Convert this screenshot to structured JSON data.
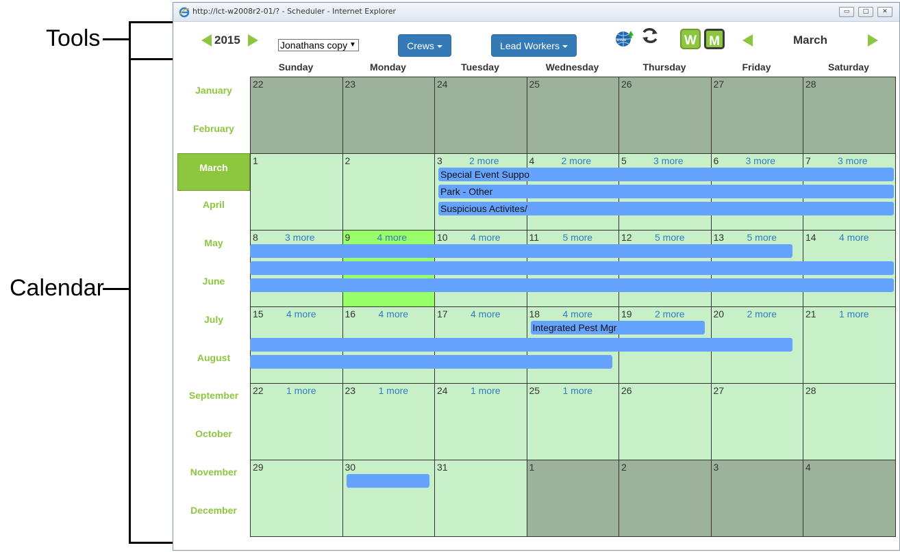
{
  "annotations": {
    "tools_label": "Tools",
    "calendar_label": "Calendar"
  },
  "window": {
    "title": "http://lct-w2008r2-01/? - Scheduler - Internet Explorer",
    "minimize": "▭",
    "restore": "□",
    "close": "✕"
  },
  "toolbar": {
    "year": "2015",
    "crew_select_value": "Jonathans copy",
    "crews_button": "Crews",
    "lead_workers_button": "Lead Workers",
    "week_view_label": "W",
    "month_view_label": "M",
    "current_month": "March"
  },
  "months": [
    "January",
    "February",
    "March",
    "April",
    "May",
    "June",
    "July",
    "August",
    "September",
    "October",
    "November",
    "December"
  ],
  "active_month_index": 2,
  "weekdays": [
    "Sunday",
    "Monday",
    "Tuesday",
    "Wednesday",
    "Thursday",
    "Friday",
    "Saturday"
  ],
  "weeks": [
    [
      {
        "d": "22",
        "t": "other"
      },
      {
        "d": "23",
        "t": "other"
      },
      {
        "d": "24",
        "t": "other"
      },
      {
        "d": "25",
        "t": "other"
      },
      {
        "d": "26",
        "t": "other"
      },
      {
        "d": "27",
        "t": "other"
      },
      {
        "d": "28",
        "t": "other"
      }
    ],
    [
      {
        "d": "1",
        "t": "cur"
      },
      {
        "d": "2",
        "t": "cur"
      },
      {
        "d": "3",
        "t": "cur",
        "more": "2 more"
      },
      {
        "d": "4",
        "t": "cur",
        "more": "2 more"
      },
      {
        "d": "5",
        "t": "cur",
        "more": "3 more"
      },
      {
        "d": "6",
        "t": "cur",
        "more": "3 more"
      },
      {
        "d": "7",
        "t": "cur",
        "more": "3 more"
      }
    ],
    [
      {
        "d": "8",
        "t": "cur",
        "more": "3 more"
      },
      {
        "d": "9",
        "t": "today",
        "more": "4 more"
      },
      {
        "d": "10",
        "t": "cur",
        "more": "4 more"
      },
      {
        "d": "11",
        "t": "cur",
        "more": "5 more"
      },
      {
        "d": "12",
        "t": "cur",
        "more": "5 more"
      },
      {
        "d": "13",
        "t": "cur",
        "more": "5 more"
      },
      {
        "d": "14",
        "t": "cur",
        "more": "4 more"
      }
    ],
    [
      {
        "d": "15",
        "t": "cur",
        "more": "4 more"
      },
      {
        "d": "16",
        "t": "cur",
        "more": "4 more"
      },
      {
        "d": "17",
        "t": "cur",
        "more": "4 more"
      },
      {
        "d": "18",
        "t": "cur",
        "more": "4 more"
      },
      {
        "d": "19",
        "t": "cur",
        "more": "2 more"
      },
      {
        "d": "20",
        "t": "cur",
        "more": "2 more"
      },
      {
        "d": "21",
        "t": "cur",
        "more": "1 more"
      }
    ],
    [
      {
        "d": "22",
        "t": "cur",
        "more": "1 more"
      },
      {
        "d": "23",
        "t": "cur",
        "more": "1 more"
      },
      {
        "d": "24",
        "t": "cur",
        "more": "1 more"
      },
      {
        "d": "25",
        "t": "cur",
        "more": "1 more"
      },
      {
        "d": "26",
        "t": "cur"
      },
      {
        "d": "27",
        "t": "cur"
      },
      {
        "d": "28",
        "t": "cur"
      }
    ],
    [
      {
        "d": "29",
        "t": "cur"
      },
      {
        "d": "30",
        "t": "cur"
      },
      {
        "d": "31",
        "t": "cur"
      },
      {
        "d": "1",
        "t": "other"
      },
      {
        "d": "2",
        "t": "other"
      },
      {
        "d": "3",
        "t": "other"
      },
      {
        "d": "4",
        "t": "other"
      }
    ]
  ],
  "events": [
    {
      "week": 1,
      "start": 2,
      "end": 6,
      "lane": 0,
      "label": "Special Event Suppo"
    },
    {
      "week": 1,
      "start": 2,
      "end": 6,
      "lane": 1,
      "label": "Park - Other"
    },
    {
      "week": 1,
      "start": 2,
      "end": 6,
      "lane": 2,
      "label": "Suspicious Activites/"
    },
    {
      "week": 2,
      "start": 0,
      "end": 4.9,
      "lane": 0,
      "label": ""
    },
    {
      "week": 2,
      "start": 0,
      "end": 6,
      "lane": 1,
      "label": ""
    },
    {
      "week": 2,
      "start": 0,
      "end": 6,
      "lane": 2,
      "label": ""
    },
    {
      "week": 3,
      "start": 3,
      "end": 3.95,
      "lane": 0,
      "label": "Integrated Pest Mgr"
    },
    {
      "week": 3,
      "start": 0,
      "end": 4.9,
      "lane": 1,
      "label": ""
    },
    {
      "week": 3,
      "start": 0,
      "end": 2.95,
      "lane": 2,
      "label": ""
    },
    {
      "week": 5,
      "start": 1,
      "end": 1.95,
      "lane": 0,
      "label": ""
    }
  ]
}
